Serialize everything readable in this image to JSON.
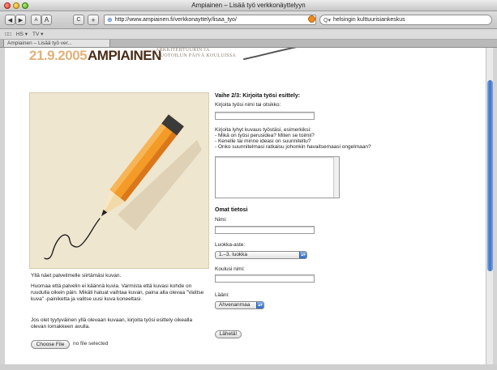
{
  "window": {
    "title": "Ampiainen – Lisää työ verkkonäyttelyyn"
  },
  "toolbar": {
    "back_glyph": "◀",
    "forward_glyph": "▶",
    "text_smaller": "A",
    "text_larger": "A",
    "reload_glyph": "C",
    "add_glyph": "+",
    "url": "http://www.ampiainen.fi/verkkonayttely/lisaa_tyo/",
    "search_value": "helsingin kulttuurisiankeskus"
  },
  "bookmarks": {
    "items": [
      "□□",
      "HS ▾",
      "TV ▾"
    ]
  },
  "tab": {
    "label": "Ampiainen – Lisää työ ver..."
  },
  "header": {
    "date": "21.9.2005",
    "name": "AMPIAINEN",
    "subtitle_line1": "ARKKITEHTUURIN JA",
    "subtitle_line2": "MUOTOILUN PÄIVÄ KOULUISSA"
  },
  "form": {
    "step_heading": "Vaihe 2/3: Kirjoita työsi esittely:",
    "work_name_label": "Kirjoita työsi nimi tai otsikko:",
    "desc_label": "Kirjoita lyhyt kuvaus työstäsi, esimerkiksi:",
    "desc_hint_1": "- Mikä on työsi perusidea? Miten se toimii?",
    "desc_hint_2": "- Kenelle tai minne ideasi on suunniteltu?",
    "desc_hint_3": "- Onko suunnitelmasi ratkaisu johonkin havaitsemaasi ongelmaan?",
    "own_info_heading": "Omat tietosi",
    "name_label": "Nimi:",
    "grade_label": "Luokka-aste:",
    "grade_value": "1.–3. luokka",
    "school_label": "Koulusi nimi:",
    "county_label": "Lääni:",
    "county_value": "Ahvenanmaa",
    "submit_label": "Lähetä!"
  },
  "left": {
    "caption": "Yllä näet palvelimelle siirtämäsi kuvan.",
    "note_1": "Huomaa että palvelin ei käännä kuvia. Varmista että kuvasi kohde on ruudulla oikein päin. Mikäli haluat vaihtaa kuvan, paina alla olevaa \"Valitse kuva\" -painiketta ja valitse uusi kuva koneeltasi.",
    "note_2": "Jos olet tyytyväinen yllä olevaan kuvaan, kirjoita työsi esittely oikealla olevan lomakkeen avulla.",
    "choose_file_label": "Choose File",
    "file_status": "no file selected"
  }
}
